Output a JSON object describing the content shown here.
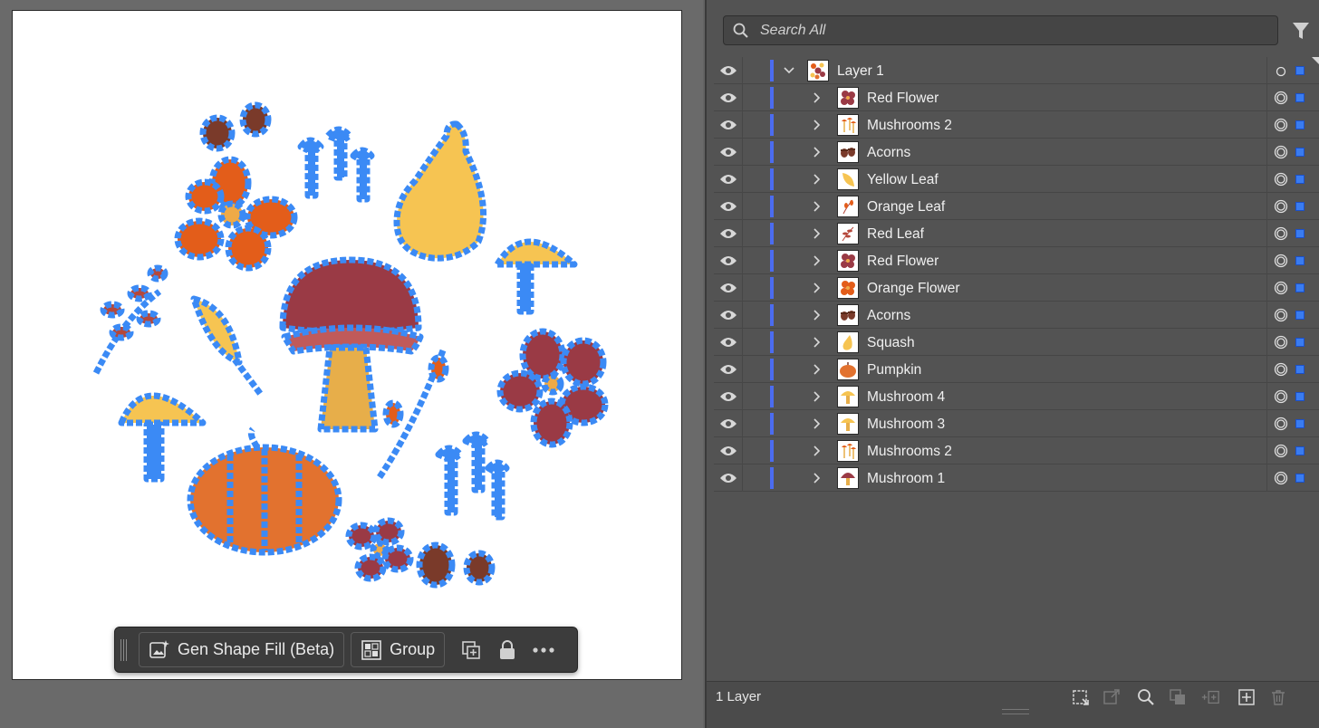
{
  "toolbar": {
    "gen_shape_fill_label": "Gen Shape Fill (Beta)",
    "group_label": "Group"
  },
  "layers_panel": {
    "search": {
      "placeholder": "Search All"
    },
    "parent_layer": {
      "name": "Layer 1"
    },
    "sublayers": [
      {
        "name": "Red Flower",
        "thumb": "red-flower"
      },
      {
        "name": "Mushrooms 2",
        "thumb": "mushrooms"
      },
      {
        "name": "Acorns",
        "thumb": "acorns"
      },
      {
        "name": "Yellow Leaf",
        "thumb": "yellow-leaf"
      },
      {
        "name": "Orange Leaf",
        "thumb": "orange-leaf"
      },
      {
        "name": "Red Leaf",
        "thumb": "red-leaf"
      },
      {
        "name": "Red Flower",
        "thumb": "red-flower"
      },
      {
        "name": "Orange Flower",
        "thumb": "orange-flower"
      },
      {
        "name": "Acorns",
        "thumb": "acorns"
      },
      {
        "name": "Squash",
        "thumb": "squash"
      },
      {
        "name": "Pumpkin",
        "thumb": "pumpkin"
      },
      {
        "name": "Mushroom 4",
        "thumb": "mushroom-yellow"
      },
      {
        "name": "Mushroom 3",
        "thumb": "mushroom-yellow"
      },
      {
        "name": "Mushrooms 2",
        "thumb": "mushrooms"
      },
      {
        "name": "Mushroom 1",
        "thumb": "mushroom-red"
      }
    ],
    "layer_count": "1 Layer",
    "colors": {
      "layer_color": "#4b6cf0",
      "selection": "#3a7cf0"
    }
  }
}
